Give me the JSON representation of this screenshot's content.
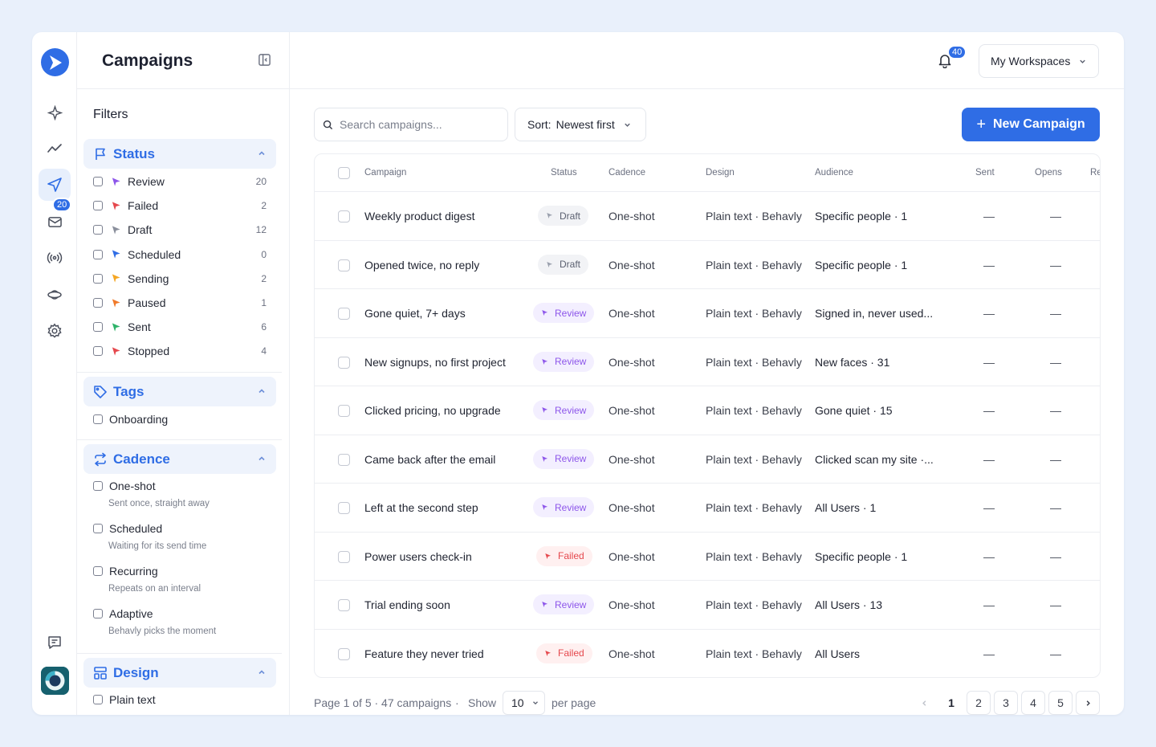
{
  "app": {
    "title": "Campaigns",
    "rail_badge": "20",
    "notifications_badge": "40",
    "workspace_label": "My Workspaces",
    "accent_color": "#2f6de5"
  },
  "sidebar": {
    "filters_label": "Filters",
    "status": {
      "label": "Status",
      "items": [
        {
          "label": "Review",
          "count": "20",
          "color": "#8d56ea"
        },
        {
          "label": "Failed",
          "count": "2",
          "color": "#e5484d"
        },
        {
          "label": "Draft",
          "count": "12",
          "color": "#8a8f9c"
        },
        {
          "label": "Scheduled",
          "count": "0",
          "color": "#2f6de5"
        },
        {
          "label": "Sending",
          "count": "2",
          "color": "#f5a623"
        },
        {
          "label": "Paused",
          "count": "1",
          "color": "#f07a2a"
        },
        {
          "label": "Sent",
          "count": "6",
          "color": "#2fb36a"
        },
        {
          "label": "Stopped",
          "count": "4",
          "color": "#e5484d"
        }
      ]
    },
    "tags": {
      "label": "Tags",
      "items": [
        {
          "label": "Onboarding"
        }
      ]
    },
    "cadence": {
      "label": "Cadence",
      "items": [
        {
          "label": "One-shot",
          "sub": "Sent once, straight away"
        },
        {
          "label": "Scheduled",
          "sub": "Waiting for its send time"
        },
        {
          "label": "Recurring",
          "sub": "Repeats on an interval"
        },
        {
          "label": "Adaptive",
          "sub": "Behavly picks the moment"
        }
      ]
    },
    "design": {
      "label": "Design",
      "items": [
        {
          "label": "Plain text"
        }
      ]
    }
  },
  "toolbar": {
    "search_placeholder": "Search campaigns...",
    "sort_label": "Sort:",
    "sort_value": "Newest first",
    "new_button": "New Campaign"
  },
  "table": {
    "headers": {
      "campaign": "Campaign",
      "status": "Status",
      "cadence": "Cadence",
      "design": "Design",
      "audience": "Audience",
      "sent": "Sent",
      "opens": "Opens",
      "replies": "Re"
    },
    "rows": [
      {
        "campaign": "Weekly product digest",
        "status": "Draft",
        "status_kind": "draft",
        "cadence": "One-shot",
        "design": "Plain text · Behavly",
        "audience": "Specific people · 1",
        "sent": "—",
        "opens": "—"
      },
      {
        "campaign": "Opened twice, no reply",
        "status": "Draft",
        "status_kind": "draft",
        "cadence": "One-shot",
        "design": "Plain text · Behavly",
        "audience": "Specific people · 1",
        "sent": "—",
        "opens": "—"
      },
      {
        "campaign": "Gone quiet, 7+ days",
        "status": "Review",
        "status_kind": "review",
        "cadence": "One-shot",
        "design": "Plain text · Behavly",
        "audience": "Signed in, never used...",
        "sent": "—",
        "opens": "—"
      },
      {
        "campaign": "New signups, no first project",
        "status": "Review",
        "status_kind": "review",
        "cadence": "One-shot",
        "design": "Plain text · Behavly",
        "audience": "New faces · 31",
        "sent": "—",
        "opens": "—"
      },
      {
        "campaign": "Clicked pricing, no upgrade",
        "status": "Review",
        "status_kind": "review",
        "cadence": "One-shot",
        "design": "Plain text · Behavly",
        "audience": "Gone quiet · 15",
        "sent": "—",
        "opens": "—"
      },
      {
        "campaign": "Came back after the email",
        "status": "Review",
        "status_kind": "review",
        "cadence": "One-shot",
        "design": "Plain text · Behavly",
        "audience": "Clicked scan my site ·...",
        "sent": "—",
        "opens": "—"
      },
      {
        "campaign": "Left at the second step",
        "status": "Review",
        "status_kind": "review",
        "cadence": "One-shot",
        "design": "Plain text · Behavly",
        "audience": "All Users · 1",
        "sent": "—",
        "opens": "—"
      },
      {
        "campaign": "Power users check-in",
        "status": "Failed",
        "status_kind": "failed",
        "cadence": "One-shot",
        "design": "Plain text · Behavly",
        "audience": "Specific people · 1",
        "sent": "—",
        "opens": "—"
      },
      {
        "campaign": "Trial ending soon",
        "status": "Review",
        "status_kind": "review",
        "cadence": "One-shot",
        "design": "Plain text · Behavly",
        "audience": "All Users · 13",
        "sent": "—",
        "opens": "—"
      },
      {
        "campaign": "Feature they never tried",
        "status": "Failed",
        "status_kind": "failed",
        "cadence": "One-shot",
        "design": "Plain text · Behavly",
        "audience": "All Users",
        "sent": "—",
        "opens": "—"
      }
    ]
  },
  "pagination": {
    "info": "Page 1 of 5 · 47 campaigns",
    "separator": "·",
    "show_label": "Show",
    "per_page_value": "10",
    "per_page_label": "per page",
    "pages": [
      "1",
      "2",
      "3",
      "4",
      "5"
    ],
    "current_page": "1"
  }
}
